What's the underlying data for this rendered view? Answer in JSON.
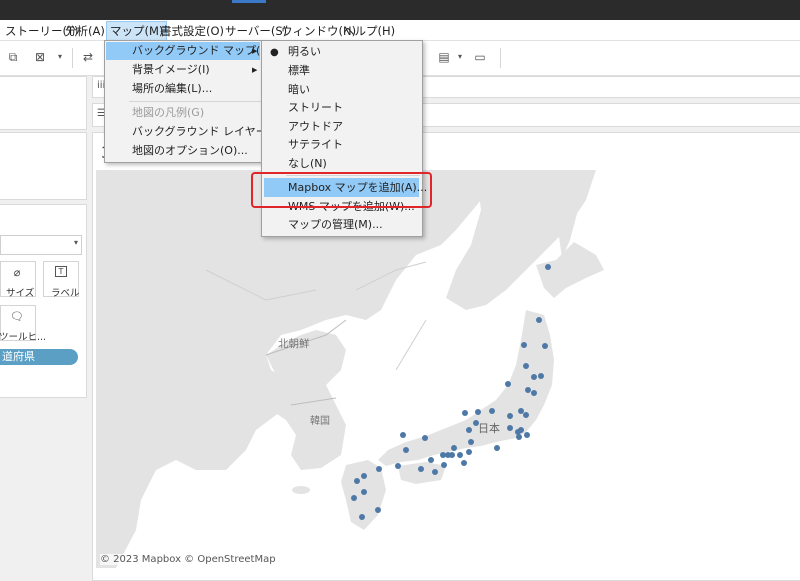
{
  "menubar": {
    "items": [
      {
        "label": "ストーリー(T)"
      },
      {
        "label": "分析(A)"
      },
      {
        "label": "マップ(M)"
      },
      {
        "label": "書式設定(O)"
      },
      {
        "label": "サーバー(S)"
      },
      {
        "label": "ウィンドウ(N)"
      },
      {
        "label": "ヘルプ(H)"
      }
    ]
  },
  "map_menu": {
    "items": [
      {
        "label": "バックグラウンド マップ(K)"
      },
      {
        "label": "背景イメージ(I)"
      },
      {
        "label": "場所の編集(L)..."
      },
      {
        "label": "地図の凡例(G)"
      },
      {
        "label": "バックグラウンド レイヤー(Y)..."
      },
      {
        "label": "地図のオプション(O)..."
      }
    ]
  },
  "background_submenu": {
    "items": [
      {
        "label": "明るい"
      },
      {
        "label": "標準"
      },
      {
        "label": "暗い"
      },
      {
        "label": "ストリート"
      },
      {
        "label": "アウトドア"
      },
      {
        "label": "サテライト"
      },
      {
        "label": "なし(N)"
      },
      {
        "label": "Mapbox マップを追加(A)..."
      },
      {
        "label": "WMS マップを追加(W)..."
      },
      {
        "label": "マップの管理(M)..."
      }
    ],
    "checked_item": "明るい"
  },
  "marks_card": {
    "size_label": "サイズ",
    "label_label": "ラベル",
    "tooltip_label": "ツールヒ...",
    "field_pill": "道府県"
  },
  "map": {
    "labels": {
      "north_korea": "北朝鮮",
      "south_korea": "韓国",
      "japan": "日本"
    },
    "attribution": "© 2023 Mapbox © OpenStreetMap"
  },
  "colors": {
    "highlight": "#91c9f7",
    "callout": "#e0262b",
    "point": "#4e79a7",
    "pill": "#5b9fc4"
  }
}
